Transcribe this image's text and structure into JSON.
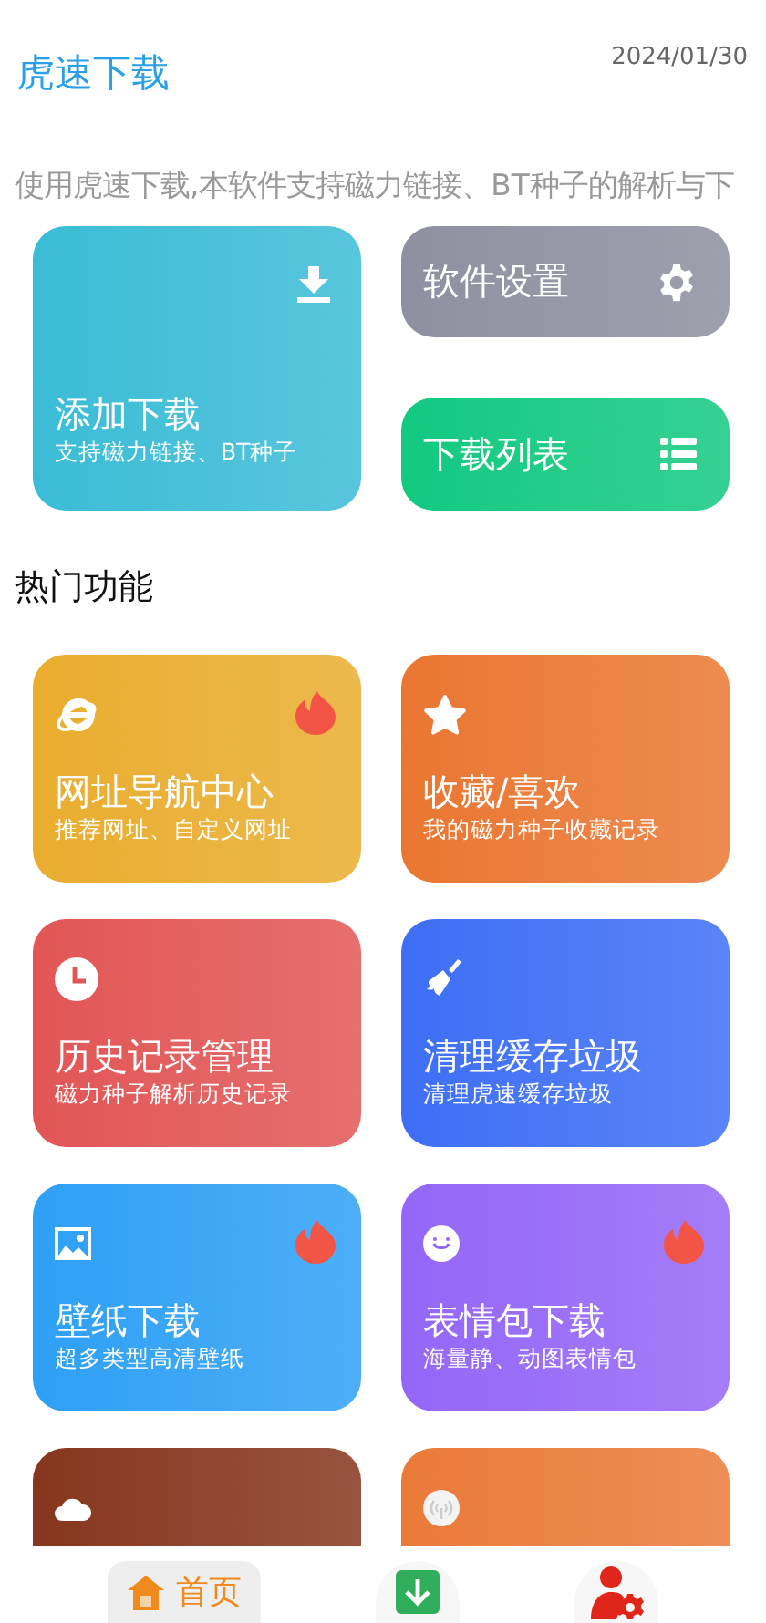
{
  "header": {
    "title": "虎速下载",
    "date": "2024/01/30"
  },
  "notice": "使用虎速下载,本软件支持磁力链接、BT种子的解析与下",
  "quick": [
    {
      "kind": "add",
      "title": "添加下载",
      "subtitle": "支持磁力链接、BT种子",
      "color": "#3bbcd6"
    },
    {
      "kind": "settings",
      "title": "软件设置",
      "color": "#8e8fa0"
    },
    {
      "kind": "list",
      "title": "下载列表",
      "color": "#12c97f"
    }
  ],
  "section_title": "热门功能",
  "features": [
    {
      "kind": "browser",
      "title": "网址导航中心",
      "subtitle": "推荐网址、自定义网址",
      "hot": true,
      "color": "#e9ad2e"
    },
    {
      "kind": "star",
      "title": "收藏/喜欢",
      "subtitle": "我的磁力种子收藏记录",
      "hot": false,
      "color": "#ea7631"
    },
    {
      "kind": "clock",
      "title": "历史记录管理",
      "subtitle": "磁力种子解析历史记录",
      "hot": false,
      "color": "#e25555"
    },
    {
      "kind": "broom",
      "title": "清理缓存垃圾",
      "subtitle": "清理虎速缓存垃圾",
      "hot": false,
      "color": "#3d6ef5"
    },
    {
      "kind": "image",
      "title": "壁纸下载",
      "subtitle": "超多类型高清壁纸",
      "hot": true,
      "color": "#2ea0f5"
    },
    {
      "kind": "smile",
      "title": "表情包下载",
      "subtitle": "海量静、动图表情包",
      "hot": true,
      "color": "#9466f7"
    },
    {
      "kind": "cloud",
      "hot": false,
      "color": "#86361d"
    },
    {
      "kind": "signal",
      "hot": false,
      "color": "#ea7a38"
    }
  ],
  "nav": [
    {
      "kind": "home",
      "label": "首页",
      "selected": true
    },
    {
      "kind": "download",
      "selected": false
    },
    {
      "kind": "profile",
      "selected": false
    }
  ]
}
